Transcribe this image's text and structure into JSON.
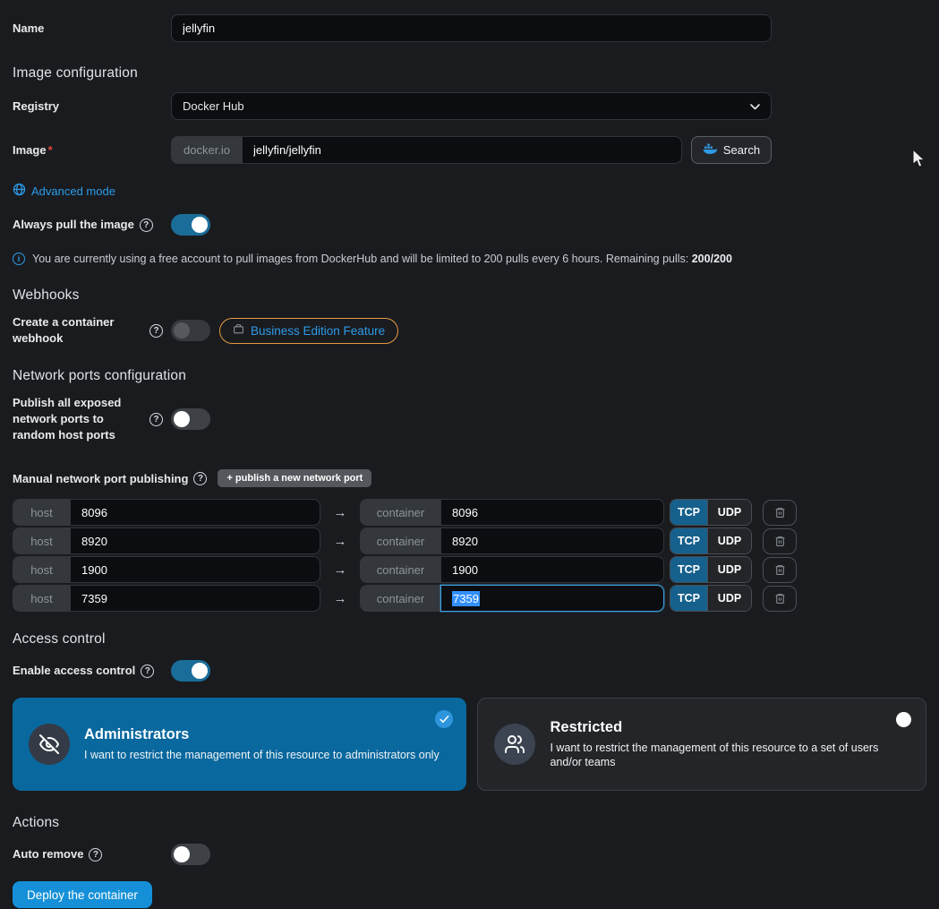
{
  "colors": {
    "accent_blue": "#2e9be8",
    "toggle_on": "#1b6d99",
    "card_selected": "#09689e",
    "deploy_button": "#1590d8",
    "be_badge_border": "#e39b3e",
    "tcp_active": "#15608c"
  },
  "name_row": {
    "label": "Name",
    "value": "jellyfin"
  },
  "image_config": {
    "title": "Image configuration",
    "registry": {
      "label": "Registry",
      "value": "Docker Hub"
    },
    "image": {
      "label": "Image",
      "required_mark": "*",
      "prefix": "docker.io",
      "value": "jellyfin/jellyfin",
      "search_label": "Search"
    },
    "advanced_mode_label": "Advanced mode",
    "always_pull_label": "Always pull the image",
    "notice_text": "You are currently using a free account to pull images from DockerHub and will be limited to 200 pulls every 6 hours. Remaining pulls:",
    "notice_remaining": "200/200",
    "info_glyph": "i",
    "question_glyph": "?"
  },
  "webhooks": {
    "title": "Webhooks",
    "create_label": "Create a container webhook",
    "badge_label": "Business Edition Feature"
  },
  "network": {
    "title": "Network ports configuration",
    "publish_all_label": "Publish all exposed network ports to random host ports",
    "manual_label": "Manual network port publishing",
    "add_button_label": "+ publish a new network port",
    "host_prefix": "host",
    "container_prefix": "container",
    "tcp_label": "TCP",
    "udp_label": "UDP",
    "arrow_glyph": "→",
    "ports": [
      {
        "host": "8096",
        "container": "8096",
        "protocol": "TCP"
      },
      {
        "host": "8920",
        "container": "8920",
        "protocol": "TCP"
      },
      {
        "host": "1900",
        "container": "1900",
        "protocol": "TCP"
      },
      {
        "host": "7359",
        "container": "7359",
        "protocol": "TCP",
        "state": "focused-text-selected"
      }
    ]
  },
  "access_control": {
    "title": "Access control",
    "enable_label": "Enable access control",
    "options": [
      {
        "title": "Administrators",
        "description": "I want to restrict the management of this resource to administrators only",
        "selected": true
      },
      {
        "title": "Restricted",
        "description": "I want to restrict the management of this resource to a set of users and/or teams",
        "selected": false
      }
    ]
  },
  "actions": {
    "title": "Actions",
    "auto_remove_label": "Auto remove",
    "deploy_label": "Deploy the container"
  }
}
